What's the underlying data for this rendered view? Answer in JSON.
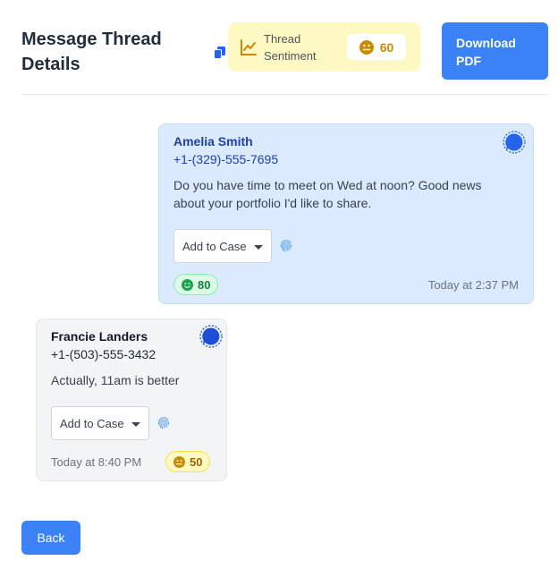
{
  "header": {
    "title": "Message Thread Details",
    "sentiment_label": "Thread Sentiment",
    "sentiment_score": "60",
    "download_label": "Download PDF"
  },
  "messages": [
    {
      "direction": "outgoing",
      "sender": "Amelia Smith",
      "phone": "+1-(329)-555-7695",
      "body": "Do you have time to meet on Wed at noon? Good news about your portfolio I'd like to share.",
      "case_select": "Add to Case",
      "sentiment": "80",
      "sentiment_mood": "happy",
      "timestamp": "Today at 2:37 PM"
    },
    {
      "direction": "incoming",
      "sender": "Francie Landers",
      "phone": "+1-(503)-555-3432",
      "body": "Actually, 11am is better",
      "case_select": "Add to Case",
      "sentiment": "50",
      "sentiment_mood": "neutral",
      "timestamp": "Today at 8:40 PM"
    }
  ],
  "back_label": "Back",
  "colors": {
    "primary": "#3b82f6",
    "outgoing_bg": "#dbeafe",
    "incoming_bg": "#f3f4f6",
    "sentiment_bg": "#fef9c3",
    "positive": "#16a34a",
    "neutral": "#ca8a04"
  },
  "icons": {
    "copy": "copy-icon",
    "trend": "trend-chart-icon",
    "signal": "signal-chat-icon",
    "fingerprint": "fingerprint-icon",
    "caret": "caret-down-icon",
    "smile": "smile-face-icon",
    "neutral_face": "neutral-face-icon"
  }
}
